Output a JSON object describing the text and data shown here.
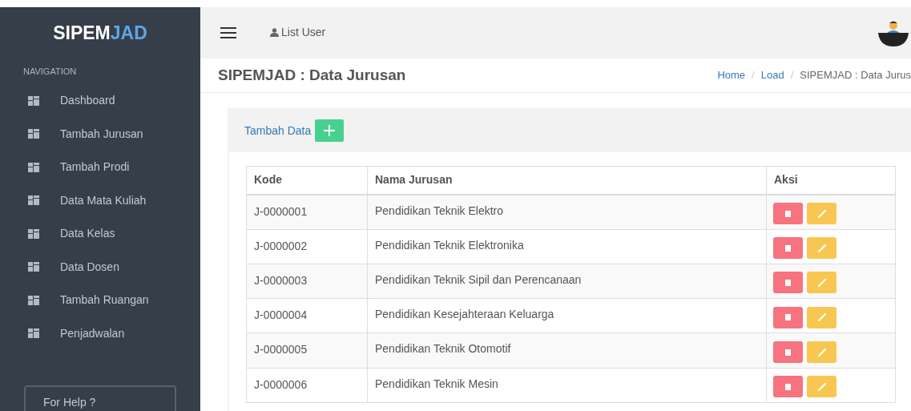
{
  "sidebar": {
    "brand": {
      "primary": "SIPEM",
      "accent": "JAD"
    },
    "section": "NAVIGATION",
    "items": [
      {
        "label": "Dashboard"
      },
      {
        "label": "Tambah Jurusan"
      },
      {
        "label": "Tambah Prodi"
      },
      {
        "label": "Data Mata Kuliah"
      },
      {
        "label": "Data Kelas"
      },
      {
        "label": "Data Dosen"
      },
      {
        "label": "Tambah Ruangan"
      },
      {
        "label": "Penjadwalan"
      }
    ],
    "help": "For Help ?"
  },
  "topbar": {
    "link": "List User"
  },
  "header": {
    "title": "SIPEMJAD : Data Jurusan",
    "separator": "/",
    "breadcrumb": [
      {
        "label": "Home",
        "link": true
      },
      {
        "label": "Load",
        "link": true
      },
      {
        "label": "SIPEMJAD : Data Jurus",
        "link": false
      }
    ]
  },
  "card": {
    "add_label": "Tambah Data"
  },
  "table": {
    "columns": [
      "Kode",
      "Nama Jurusan",
      "Aksi"
    ],
    "rows": [
      {
        "kode": "J-0000001",
        "nama": "Pendidikan Teknik Elektro"
      },
      {
        "kode": "J-0000002",
        "nama": "Pendidikan Teknik Elektronika"
      },
      {
        "kode": "J-0000003",
        "nama": "Pendidikan Teknik Sipil dan Perencanaan"
      },
      {
        "kode": "J-0000004",
        "nama": "Pendidikan Kesejahteraan Keluarga"
      },
      {
        "kode": "J-0000005",
        "nama": "Pendidikan Teknik Otomotif"
      },
      {
        "kode": "J-0000006",
        "nama": "Pendidikan Teknik Mesin"
      }
    ]
  }
}
